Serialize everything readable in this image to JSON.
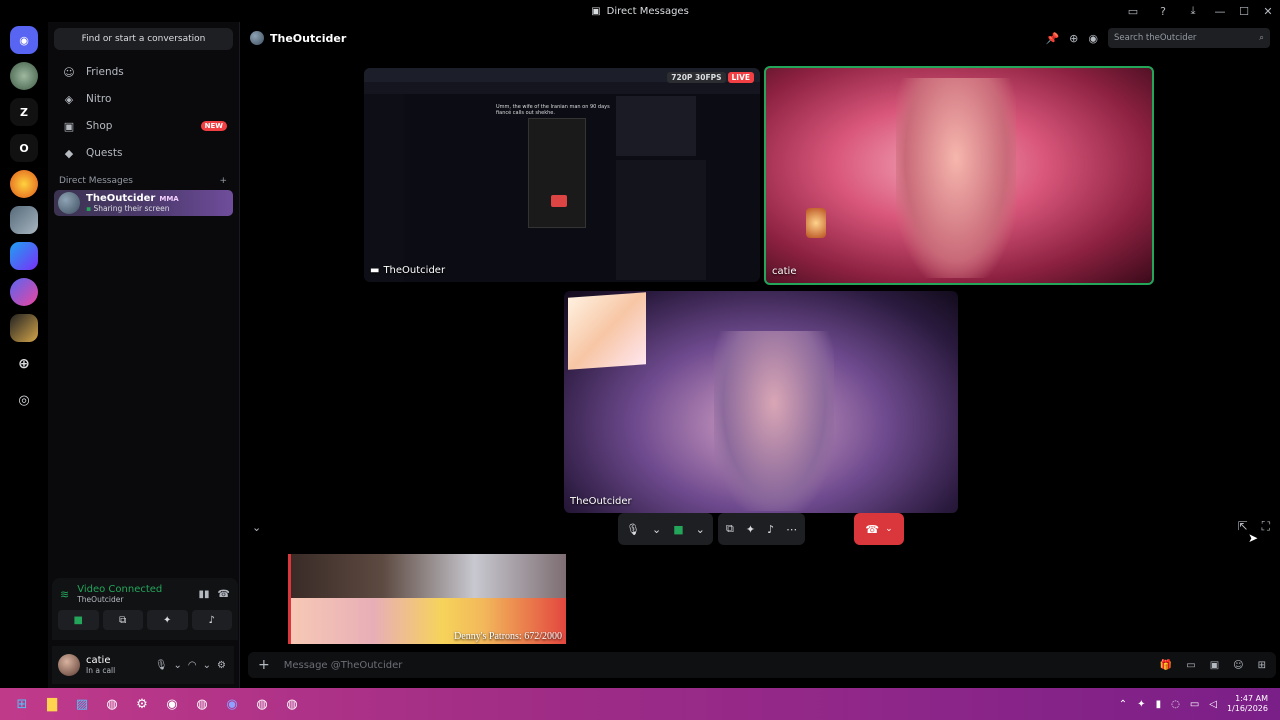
{
  "window": {
    "title": "Direct Messages"
  },
  "guilds": [
    {
      "name": "discord-home",
      "label": ""
    },
    {
      "name": "server-1",
      "label": ""
    },
    {
      "name": "server-z",
      "label": "Z"
    },
    {
      "name": "server-o",
      "label": "O"
    },
    {
      "name": "server-4",
      "label": ""
    },
    {
      "name": "server-5",
      "label": ""
    },
    {
      "name": "server-6",
      "label": ""
    },
    {
      "name": "server-7",
      "label": ""
    },
    {
      "name": "server-8",
      "label": ""
    }
  ],
  "sidebar": {
    "search_label": "Find or start a conversation",
    "nav": [
      {
        "label": "Friends",
        "icon": "friends-icon"
      },
      {
        "label": "Nitro",
        "icon": "nitro-icon"
      },
      {
        "label": "Shop",
        "icon": "shop-icon",
        "badge": "NEW"
      },
      {
        "label": "Quests",
        "icon": "quests-icon"
      }
    ],
    "dm_header": "Direct Messages",
    "dm": {
      "name": "TheOutcider",
      "tag": "MMA",
      "status": "Sharing their screen"
    }
  },
  "voice": {
    "title": "Video Connected",
    "subtitle": "TheOutcider"
  },
  "user": {
    "name": "catie",
    "status": "In a call"
  },
  "channel": {
    "name": "TheOutcider",
    "search_placeholder": "Search theOutcider"
  },
  "stream": {
    "quality": "720P 30FPS",
    "live": "LIVE",
    "sharer": "TheOutcider",
    "shared_title": "Umm, the wife of the Iranian man on 90 days fiancé calls out shekhe."
  },
  "participants": [
    {
      "name": "catie"
    },
    {
      "name": "TheOutcider"
    }
  ],
  "media": {
    "caption": "Denny's Patrons: 672/2000"
  },
  "composer": {
    "placeholder": "Message @TheOutcider"
  },
  "clock": {
    "time": "1:47 AM",
    "date": "1/16/2026"
  }
}
